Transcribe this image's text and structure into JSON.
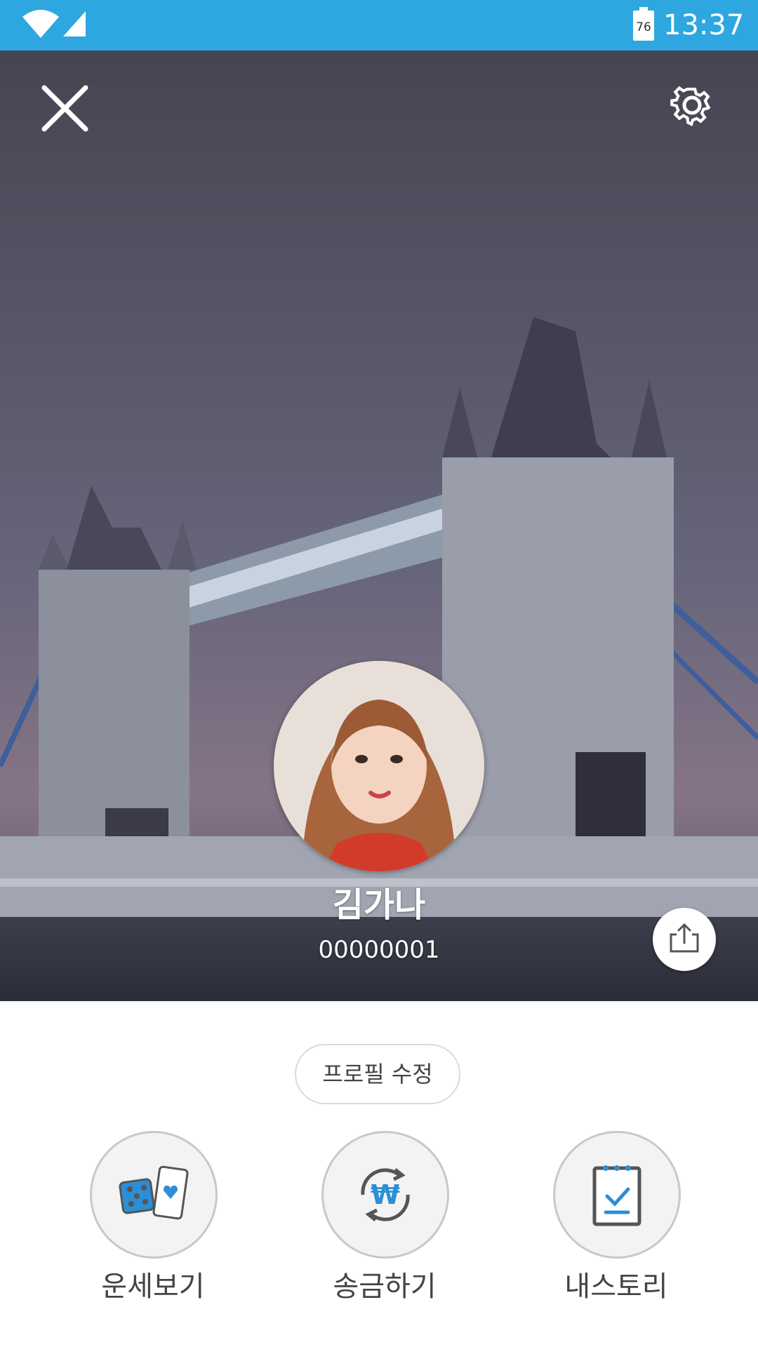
{
  "status_bar": {
    "time": "13:37",
    "battery_level": "76",
    "icons": [
      "wifi-icon",
      "signal-icon",
      "battery-icon"
    ]
  },
  "header": {
    "close_icon": "close-icon",
    "settings_icon": "gear-icon"
  },
  "profile": {
    "name": "김가나",
    "id": "00000001"
  },
  "share_icon": "share-icon",
  "edit_profile_label": "프로필 수정",
  "actions": [
    {
      "label": "운세보기",
      "icon": "fortune-icon"
    },
    {
      "label": "송금하기",
      "icon": "money-transfer-icon"
    },
    {
      "label": "내스토리",
      "icon": "my-story-icon"
    }
  ],
  "colors": {
    "status_bar": "#2ea7e0",
    "accent_blue": "#2b8ed6",
    "icon_gray": "#555555"
  }
}
